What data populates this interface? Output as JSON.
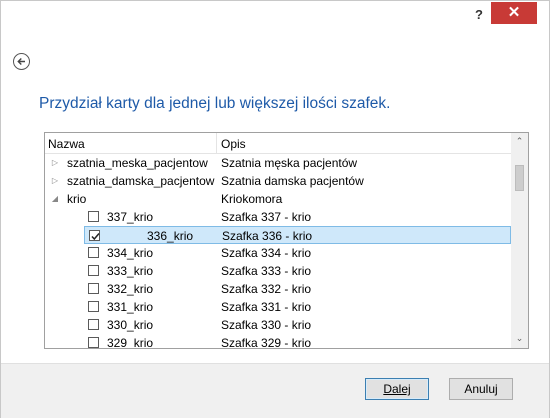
{
  "titlebar": {
    "help_label": "?",
    "close_label": "✕"
  },
  "back_icon": "arrow-left-circle-icon",
  "heading": "Przydział karty dla jednej lub większej ilości szafek.",
  "grid": {
    "columns": [
      "Nazwa",
      "Opis"
    ],
    "rows": [
      {
        "name": "szatnia_meska_pacjentow",
        "desc": "Szatnia męska pacjentów",
        "kind": "group",
        "expanded": false
      },
      {
        "name": "szatnia_damska_pacjentow",
        "desc": "Szatnia damska pacjentów",
        "kind": "group",
        "expanded": false
      },
      {
        "name": "krio",
        "desc": "Kriokomora",
        "kind": "group",
        "expanded": true
      },
      {
        "name": "337_krio",
        "desc": "Szafka 337 - krio",
        "kind": "item",
        "checked": false
      },
      {
        "name": "336_krio",
        "desc": "Szafka 336 - krio",
        "kind": "item",
        "checked": true,
        "selected": true
      },
      {
        "name": "334_krio",
        "desc": "Szafka 334 - krio",
        "kind": "item",
        "checked": false
      },
      {
        "name": "333_krio",
        "desc": "Szafka 333 - krio",
        "kind": "item",
        "checked": false
      },
      {
        "name": "332_krio",
        "desc": "Szafka 332 - krio",
        "kind": "item",
        "checked": false
      },
      {
        "name": "331_krio",
        "desc": "Szafka 331 - krio",
        "kind": "item",
        "checked": false
      },
      {
        "name": "330_krio",
        "desc": "Szafka 330 - krio",
        "kind": "item",
        "checked": false
      },
      {
        "name": "329_krio",
        "desc": "Szafka 329 - krio",
        "kind": "item",
        "checked": false
      }
    ]
  },
  "footer": {
    "next_label": "Dalej",
    "cancel_label": "Anuluj"
  }
}
